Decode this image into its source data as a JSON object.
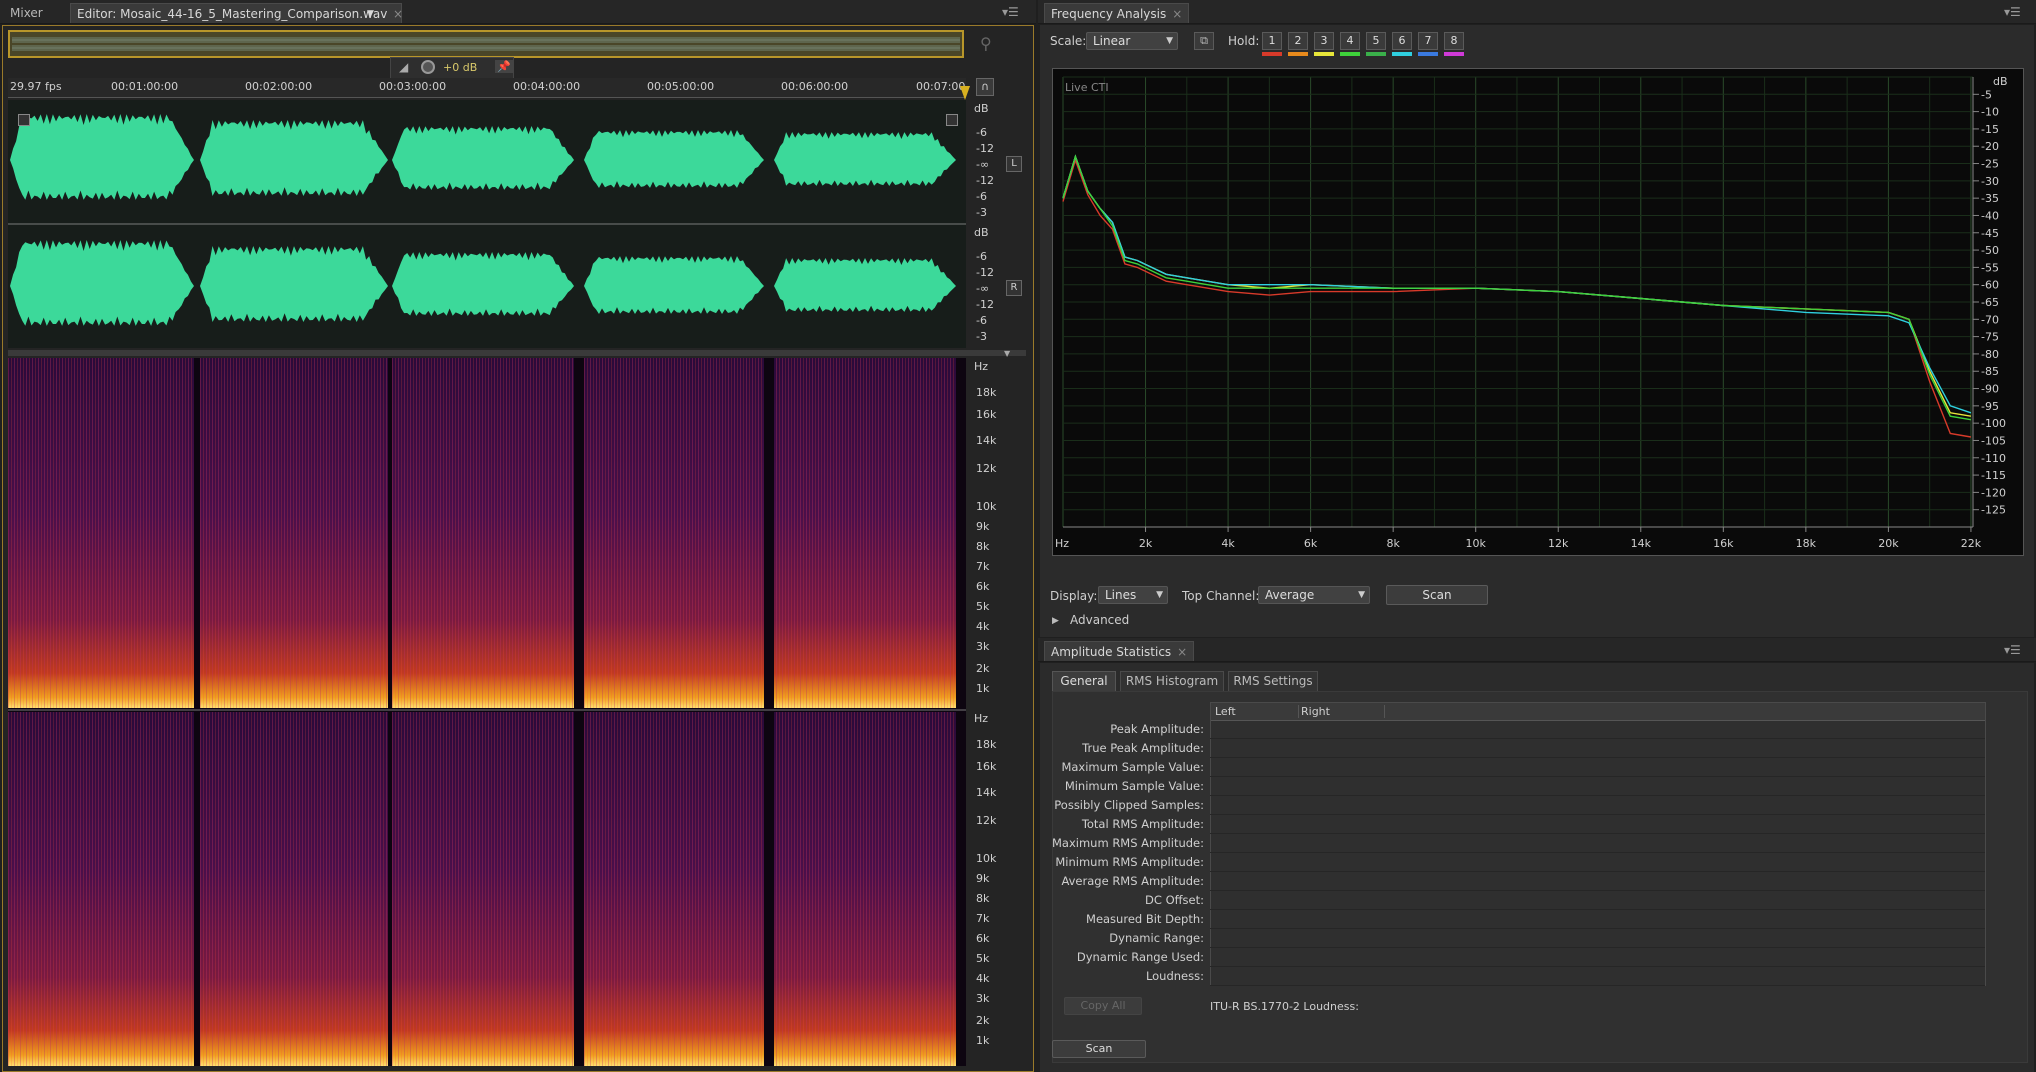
{
  "editor": {
    "tabs": [
      {
        "label": "Mixer"
      },
      {
        "label": "Editor: Mosaic_44-16_5_Mastering_Comparison.wav"
      }
    ],
    "fps": "29.97 fps",
    "gain": "+0 dB",
    "timecodes": [
      "00:01:00:00",
      "00:02:00:00",
      "00:03:00:00",
      "00:04:00:00",
      "00:05:00:00",
      "00:06:00:00",
      "00:07:00"
    ],
    "db_scale_label": "dB",
    "db_scale": [
      "-6",
      "-12",
      "-∞",
      "-12",
      "-6",
      "-3"
    ],
    "channels": [
      "L",
      "R"
    ],
    "freq_unit": "Hz",
    "freq_ticks": [
      "18k",
      "16k",
      "14k",
      "12k",
      "10k",
      "9k",
      "8k",
      "7k",
      "6k",
      "5k",
      "4k",
      "3k",
      "2k",
      "1k"
    ]
  },
  "freq": {
    "title": "Frequency Analysis",
    "scale_label": "Scale:",
    "scale_value": "Linear",
    "hold_label": "Hold:",
    "holds": [
      {
        "n": "1",
        "color": "#d83a2a"
      },
      {
        "n": "2",
        "color": "#e88a1c"
      },
      {
        "n": "3",
        "color": "#e8e63a"
      },
      {
        "n": "4",
        "color": "#3ed23a"
      },
      {
        "n": "5",
        "color": "#3ab04a"
      },
      {
        "n": "6",
        "color": "#2fd0e0"
      },
      {
        "n": "7",
        "color": "#3a7ae0"
      },
      {
        "n": "8",
        "color": "#d03ad8"
      }
    ],
    "display_label": "Display:",
    "display_value": "Lines",
    "top_channel_label": "Top Channel:",
    "top_channel_value": "Average",
    "scan": "Scan",
    "advanced": "Advanced"
  },
  "chart_data": {
    "type": "line",
    "annotation": "Live CTI",
    "xlabel": "Hz",
    "x_ticks": [
      "2k",
      "4k",
      "6k",
      "8k",
      "10k",
      "12k",
      "14k",
      "16k",
      "18k",
      "20k",
      "22k"
    ],
    "ylabel": "dB",
    "y_ticks": [
      "-5",
      "-10",
      "-15",
      "-20",
      "-25",
      "-30",
      "-35",
      "-40",
      "-45",
      "-50",
      "-55",
      "-60",
      "-65",
      "-70",
      "-75",
      "-80",
      "-85",
      "-90",
      "-95",
      "-100",
      "-105",
      "-110",
      "-115",
      "-120",
      "-125"
    ],
    "xlim": [
      0,
      22050
    ],
    "ylim": [
      -130,
      0
    ],
    "x": [
      0,
      300,
      600,
      900,
      1200,
      1500,
      1800,
      2500,
      3000,
      4000,
      5000,
      6000,
      8000,
      10000,
      12000,
      14000,
      16000,
      18000,
      20000,
      20500,
      21000,
      21500,
      22000
    ],
    "series": [
      {
        "color": "#e8e63a",
        "values": [
          -35,
          -23,
          -33,
          -38,
          -42,
          -52,
          -53,
          -57,
          -58,
          -60,
          -61,
          -60,
          -61,
          -61,
          -62,
          -64,
          -66,
          -67,
          -68,
          -70,
          -85,
          -97,
          -98
        ]
      },
      {
        "color": "#d83a2a",
        "values": [
          -36,
          -24,
          -34,
          -40,
          -44,
          -54,
          -55,
          -59,
          -60,
          -62,
          -63,
          -62,
          -62,
          -61,
          -62,
          -64,
          -66,
          -67,
          -68,
          -70,
          -88,
          -103,
          -104
        ]
      },
      {
        "color": "#2fd0e0",
        "values": [
          -35,
          -23,
          -33,
          -38,
          -42,
          -52,
          -53,
          -57,
          -58,
          -60,
          -60,
          -60,
          -61,
          -61,
          -62,
          -64,
          -66,
          -68,
          -69,
          -71,
          -84,
          -95,
          -97
        ]
      },
      {
        "color": "#3ed23a",
        "values": [
          -35,
          -23,
          -33,
          -38,
          -43,
          -53,
          -54,
          -58,
          -59,
          -61,
          -61,
          -61,
          -61,
          -61,
          -62,
          -64,
          -66,
          -67,
          -68,
          -70,
          -86,
          -98,
          -99
        ]
      }
    ],
    "grid": true
  },
  "amp": {
    "title": "Amplitude Statistics",
    "tabs": [
      "General",
      "RMS Histogram",
      "RMS Settings"
    ],
    "columns": [
      "Left",
      "Right"
    ],
    "rows": [
      "Peak Amplitude:",
      "True Peak Amplitude:",
      "Maximum Sample Value:",
      "Minimum Sample Value:",
      "Possibly Clipped Samples:",
      "Total RMS Amplitude:",
      "Maximum RMS Amplitude:",
      "Minimum RMS Amplitude:",
      "Average RMS Amplitude:",
      "DC Offset:",
      "Measured Bit Depth:",
      "Dynamic Range:",
      "Dynamic Range Used:",
      "Loudness:"
    ],
    "copy_all": "Copy All",
    "loudness_note": "ITU-R BS.1770-2 Loudness:",
    "scan": "Scan"
  }
}
